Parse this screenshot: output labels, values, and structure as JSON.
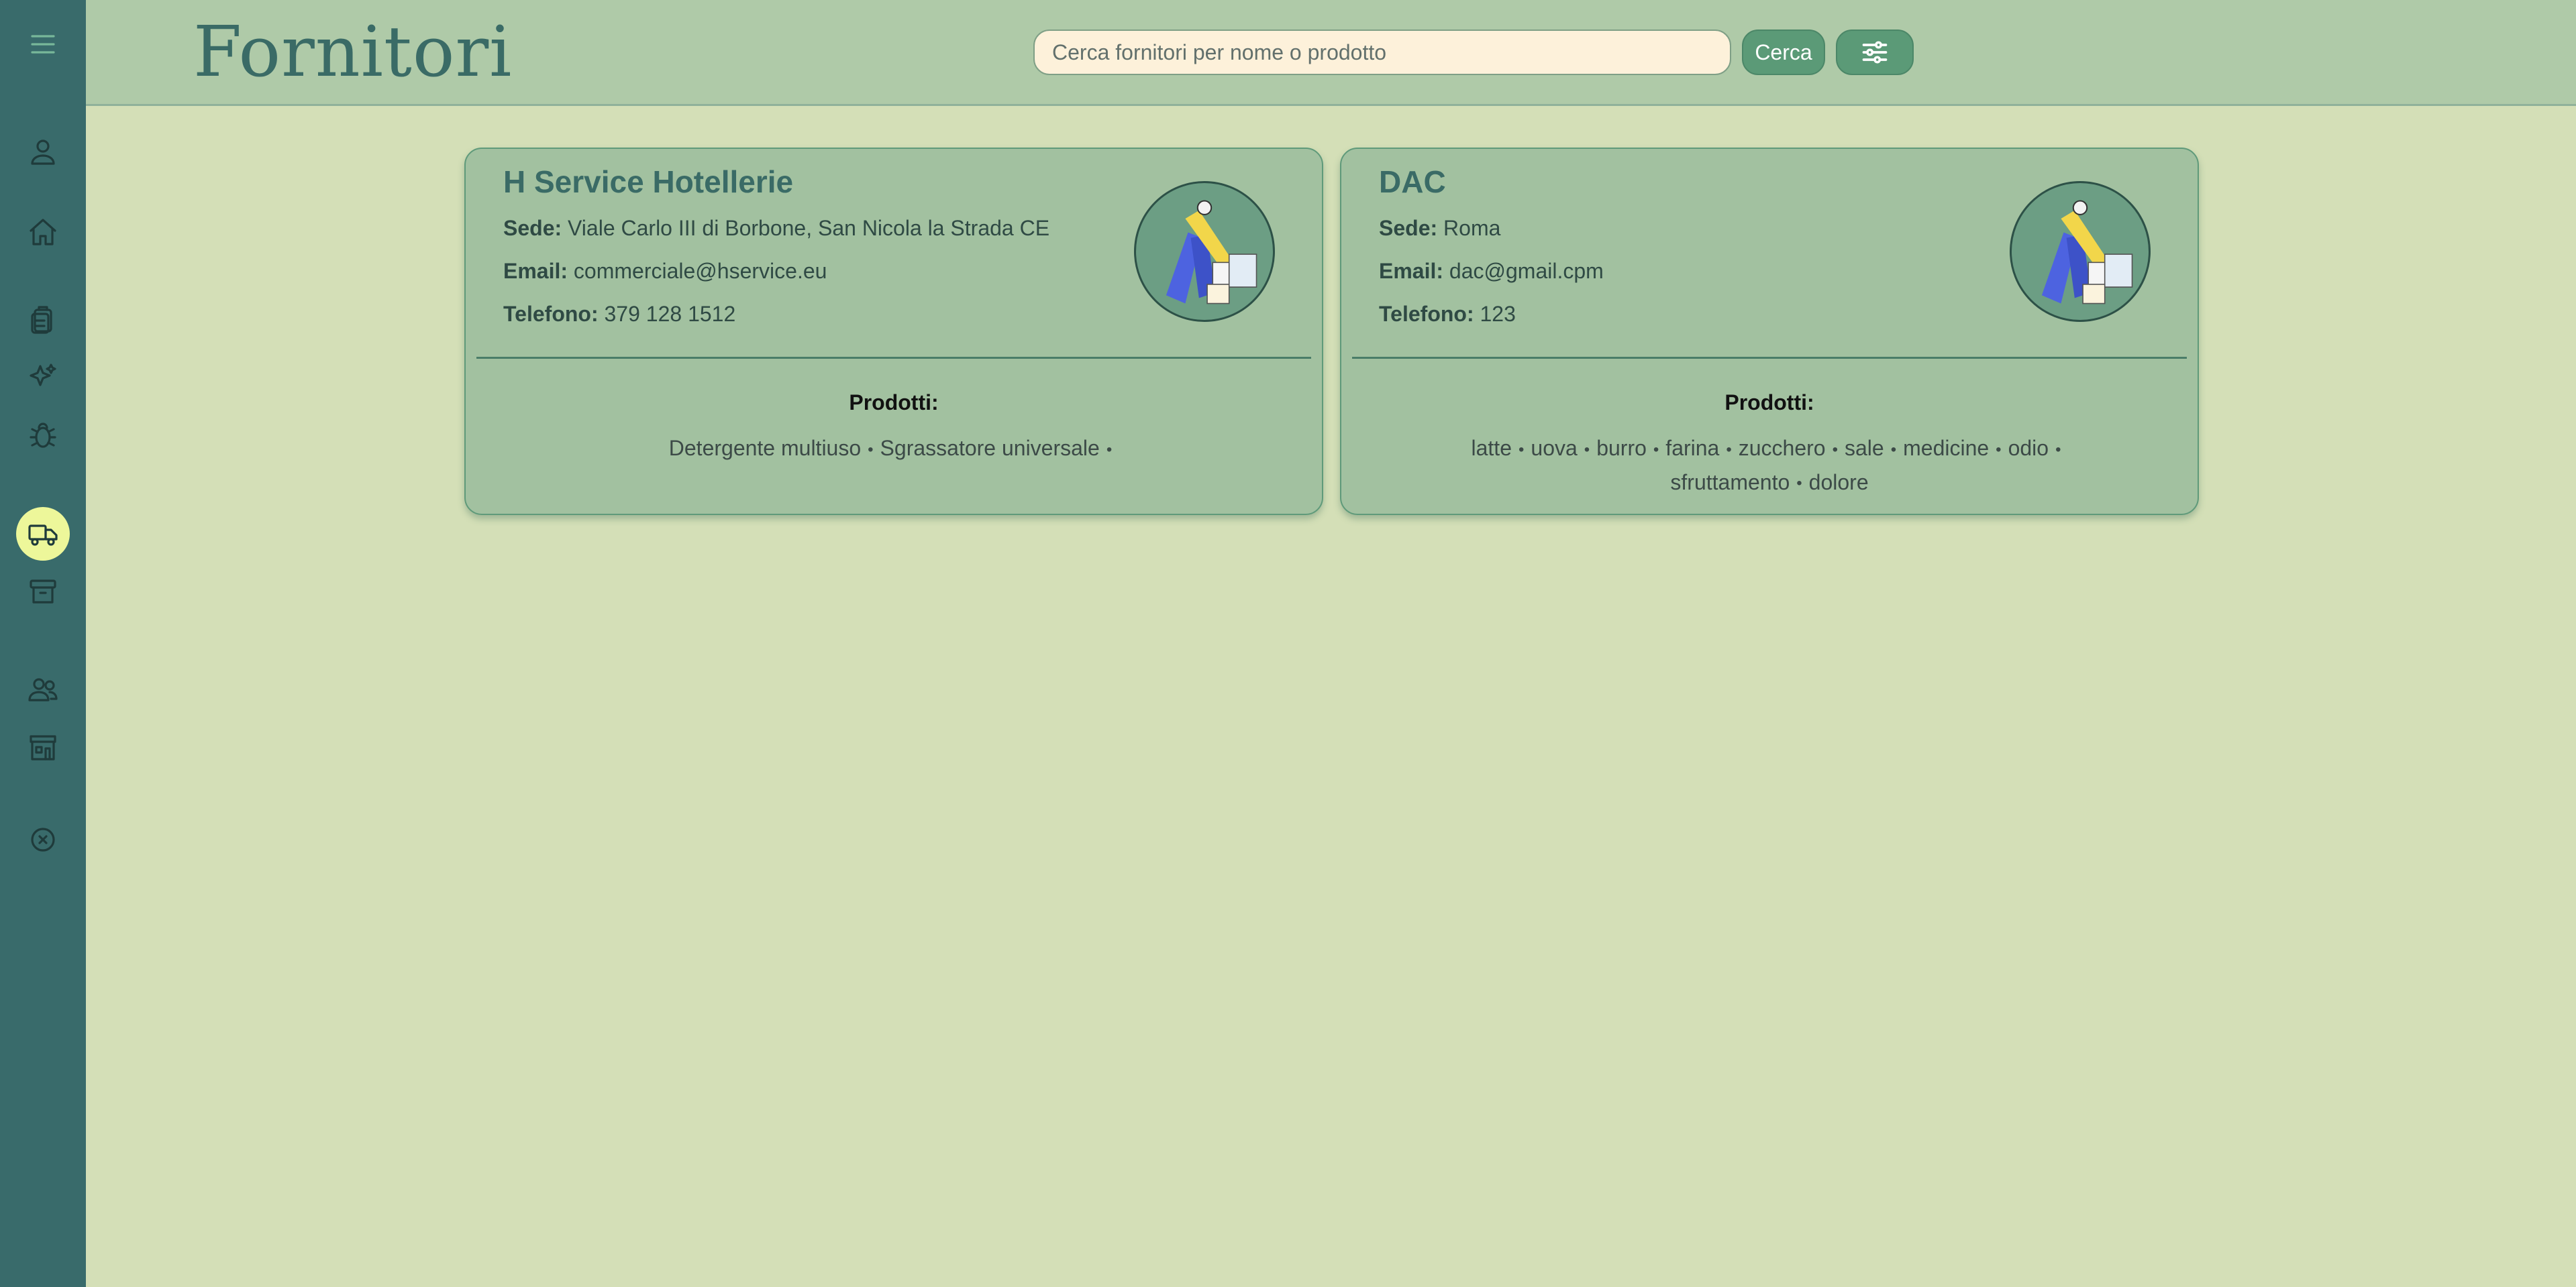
{
  "header": {
    "title": "Fornitori",
    "search_placeholder": "Cerca fornitori per nome o prodotto",
    "search_button": "Cerca"
  },
  "sidebar": {
    "items": [
      {
        "icon": "menu-icon"
      },
      {
        "icon": "user-icon"
      },
      {
        "icon": "home-icon"
      },
      {
        "icon": "clipboard-icon"
      },
      {
        "icon": "sparkles-icon"
      },
      {
        "icon": "bug-icon"
      },
      {
        "icon": "truck-icon",
        "active": true
      },
      {
        "icon": "archive-icon"
      },
      {
        "icon": "users-icon"
      },
      {
        "icon": "store-icon"
      },
      {
        "icon": "close-circle-icon"
      }
    ]
  },
  "colors": {
    "background": "#d4dfb7",
    "sidebar": "#396b6b",
    "header": "#afcaa8",
    "card": "#a2c1a0",
    "accent": "#5b9a77",
    "active": "#edf79a"
  },
  "labels": {
    "sede": "Sede:",
    "email": "Email:",
    "telefono": "Telefono:",
    "prodotti": "Prodotti:"
  },
  "suppliers": [
    {
      "name": "H Service Hotellerie",
      "sede": "Viale Carlo III di Borbone, San Nicola la Strada CE",
      "email": "commerciale@hservice.eu",
      "telefono": "379 128 1512",
      "products_line1": [
        "Detergente multiuso",
        "Sgrassatore universale"
      ],
      "products_line2": []
    },
    {
      "name": "DAC",
      "sede": "Roma",
      "email": "dac@gmail.cpm",
      "telefono": "123",
      "products_line1": [
        "latte",
        "uova",
        "burro",
        "farina",
        "zucchero",
        "sale",
        "medicine",
        "odio"
      ],
      "products_line2": [
        "sfruttamento",
        "dolore"
      ]
    }
  ]
}
